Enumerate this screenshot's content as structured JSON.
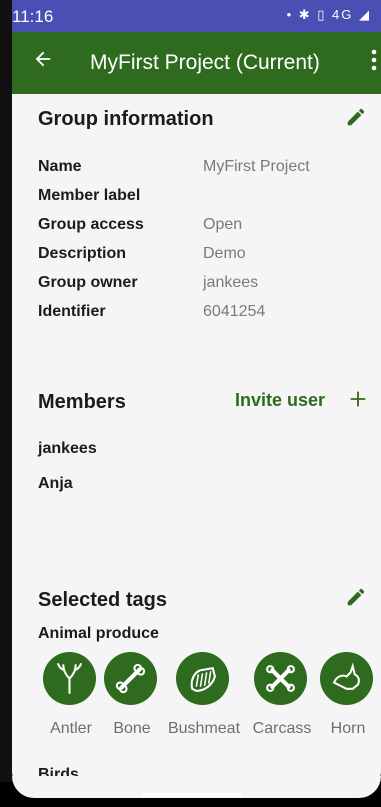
{
  "status": {
    "time": "11:16",
    "icons": "• ✱ ▯ 4G ◢"
  },
  "app_bar": {
    "title": "MyFirst Project (Current)"
  },
  "group_info": {
    "title": "Group information",
    "rows": [
      {
        "label": "Name",
        "value": "MyFirst Project"
      },
      {
        "label": "Member label",
        "value": ""
      },
      {
        "label": "Group access",
        "value": "Open"
      },
      {
        "label": "Description",
        "value": "Demo"
      },
      {
        "label": "Group owner",
        "value": "jankees"
      },
      {
        "label": "Identifier",
        "value": "6041254"
      }
    ]
  },
  "members": {
    "title": "Members",
    "invite_label": "Invite user",
    "list": [
      "jankees",
      "Anja"
    ]
  },
  "tags": {
    "title": "Selected tags",
    "categories": [
      {
        "name": "Animal produce",
        "items": [
          {
            "label": "Antler",
            "icon": "antler-icon"
          },
          {
            "label": "Bone",
            "icon": "bone-icon"
          },
          {
            "label": "Bushmeat",
            "icon": "bushmeat-icon"
          },
          {
            "label": "Carcass",
            "icon": "carcass-icon"
          },
          {
            "label": "Horn",
            "icon": "horn-icon"
          }
        ]
      },
      {
        "name": "Birds",
        "items": []
      }
    ]
  },
  "colors": {
    "primary": "#2f6b1f",
    "status_bar": "#4a4fb3",
    "background": "#f5f5f5",
    "value_text": "#7a7a7a"
  }
}
